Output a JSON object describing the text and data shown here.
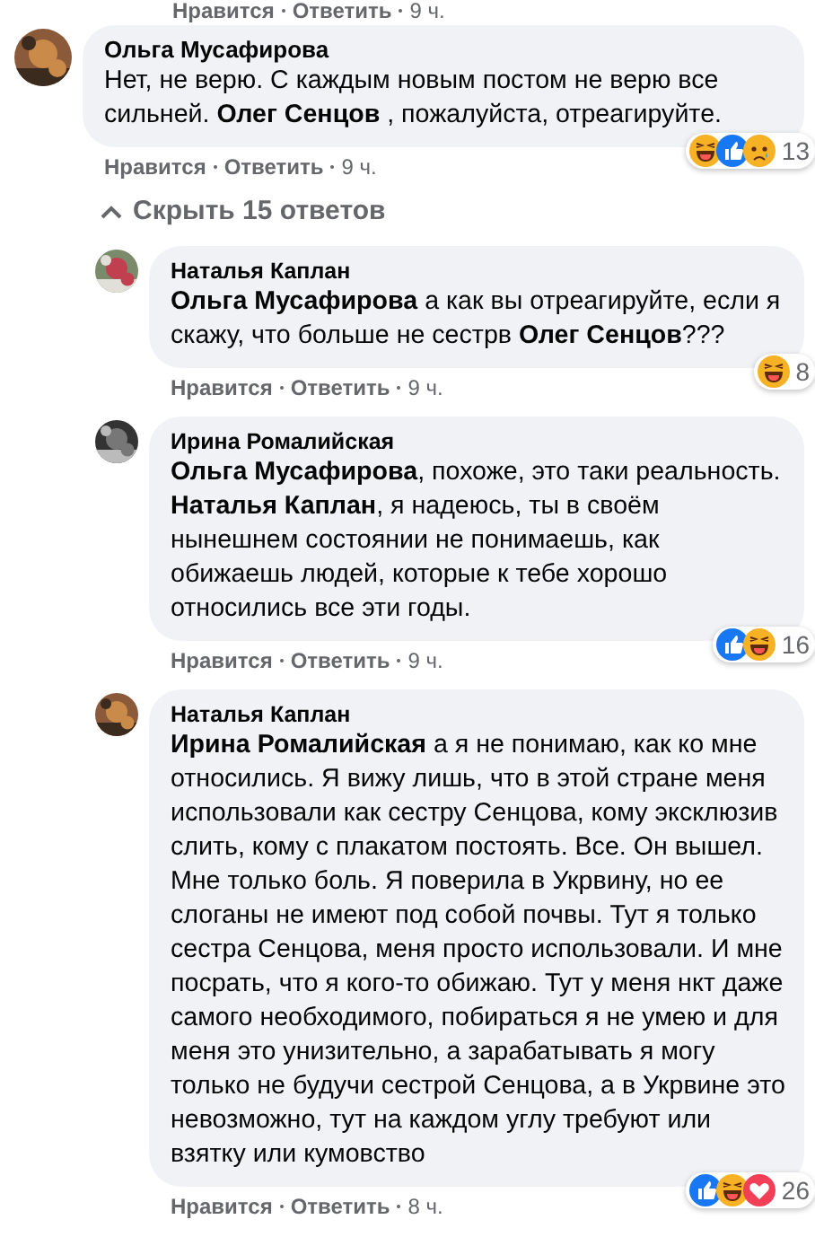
{
  "top_actions": {
    "like": "Нравится",
    "reply": "Ответить",
    "time": "9 ч."
  },
  "comment": {
    "author": "Ольга Мусафирова",
    "text": "Нет, не верю. С каждым новым постом не верю все сильней. **Олег Сенцов** , пожалуйста, отреагируйте.",
    "reactions": [
      {
        "kind": "haha"
      },
      {
        "kind": "like"
      },
      {
        "kind": "sad"
      }
    ],
    "reaction_count": "13",
    "actions": {
      "like": "Нравится",
      "reply": "Ответить",
      "time": "9 ч."
    }
  },
  "toggle_replies": {
    "label": "Скрыть 15 ответов",
    "expanded": true
  },
  "replies": [
    {
      "author": "Наталья Каплан",
      "text": "**Ольга Мусафирова** а как вы отреагируйте, если я скажу, что больше не сестрв **Олег Сенцов**???",
      "reactions": [
        {
          "kind": "haha"
        }
      ],
      "reaction_count": "8",
      "actions": {
        "like": "Нравится",
        "reply": "Ответить",
        "time": "9 ч."
      }
    },
    {
      "author": "Ирина Ромалийская",
      "text": "**Ольга Мусафирова**, похоже, это таки реальность. **Наталья Каплан**, я надеюсь, ты в своём нынешнем состоянии не понимаешь, как обижаешь людей, которые к тебе хорошо относились все эти годы.",
      "reactions": [
        {
          "kind": "like"
        },
        {
          "kind": "haha"
        }
      ],
      "reaction_count": "16",
      "actions": {
        "like": "Нравится",
        "reply": "Ответить",
        "time": "9 ч."
      }
    },
    {
      "author": "Наталья Каплан",
      "text": "**Ирина Ромалийская** а я не понимаю, как ко мне относились. Я вижу лишь, что в этой стране меня использовали как сестру Сенцова, кому эксклюзив слить, кому с плакатом постоять. Все. Он вышел. Мне только боль. Я поверила в Укрвину, но ее слоганы не имеют под собой почвы. Тут я только сестра Сенцова, меня просто использовали. И мне посрать, что я кого-то обижаю. Тут у меня нкт даже самого необходимого, побираться я не умею и для меня это унизительно, а зарабатывать я могу только не будучи сестрой Сенцова, а в Укрвине это невозможно, тут на каждом углу требуют или взятку или кумовство",
      "reactions": [
        {
          "kind": "like"
        },
        {
          "kind": "haha"
        },
        {
          "kind": "love"
        }
      ],
      "reaction_count": "26",
      "actions": {
        "like": "Нравится",
        "reply": "Ответить",
        "time": "8 ч."
      }
    }
  ]
}
